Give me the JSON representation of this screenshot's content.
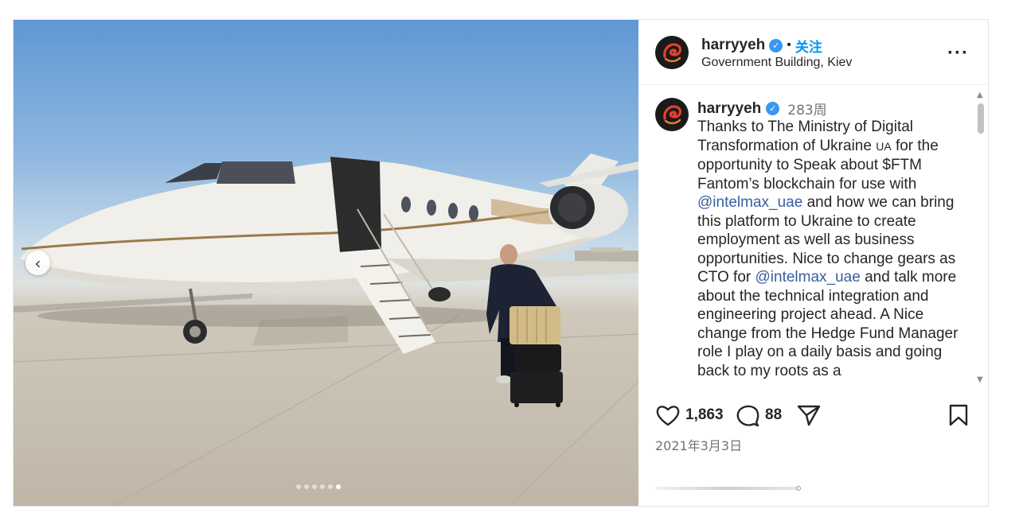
{
  "post": {
    "author": {
      "username": "harryyeh",
      "verified": true,
      "follow_label": "关注",
      "separator": "•",
      "location": "Government Building, Kiev"
    },
    "more_icon": "more-horizontal-icon",
    "media": {
      "carousel_total": 6,
      "carousel_active": 6,
      "prev_icon": "chevron-left-icon"
    },
    "caption": {
      "username": "harryyeh",
      "age": "283周",
      "parts": {
        "p1": "Thanks to The Ministry of Digital Transformation of Ukraine ",
        "flag": "UA",
        "p2": " for the opportunity to Speak about $FTM Fantom’s blockchain for use with ",
        "mention1": "@intelmax_uae",
        "p3": " and how we can bring this platform to Ukraine to create employment as well as business opportunities. Nice to change gears as CTO for ",
        "mention2": "@intelmax_uae",
        "p4": " and talk more about the technical integration and engineering project ahead. A Nice change from the Hedge Fund Manager role I play on a daily basis and going back to my roots as a"
      }
    },
    "actions": {
      "likes": "1,863",
      "comments": "88",
      "icons": [
        "heart-icon",
        "comment-icon",
        "share-icon",
        "bookmark-icon"
      ]
    },
    "date": "2021年3月3日",
    "colors": {
      "link_blue": "#0095f6",
      "verified_blue": "#3897f0",
      "mention": "#3a5fa0",
      "muted": "#737373"
    }
  }
}
